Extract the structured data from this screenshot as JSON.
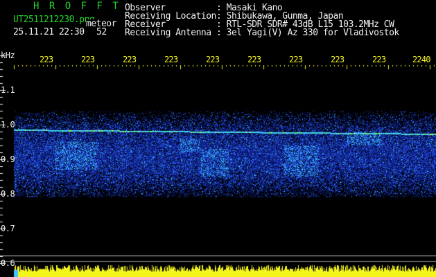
{
  "header": {
    "app_title": "H R O F F T",
    "filename": "UT2511212230.png",
    "mode": "meteor",
    "datetime": "25.11.21 22:30",
    "count": "52",
    "info": [
      {
        "label": "Observer",
        "value": ": Masaki Kano"
      },
      {
        "label": "Receiving Location",
        "value": ": Shibukawa, Gunma, Japan"
      },
      {
        "label": "Receiver",
        "value": ": RTL-SDR SDR# 43dB L15 103.2MHz CW"
      },
      {
        "label": "Receiving Antenna",
        "value": ": 3el Yagi(V) Az 330 for Vladivostok"
      }
    ]
  },
  "axes": {
    "y_unit": "kHz",
    "y_ticks": [
      "1.1",
      "1.0",
      "0.9",
      "0.8",
      "0.7",
      "0.6"
    ],
    "x_ticks": [
      "223",
      "223",
      "223",
      "223",
      "223",
      "223",
      "223",
      "223",
      "223",
      "2240"
    ]
  },
  "colors": {
    "background": "#000000",
    "title": "#22d22a",
    "text": "#f0f0f0",
    "ticks": "#f5f51e",
    "signal_band": "#1e3cc8",
    "carrier_line": "#3cc8ff",
    "level_bar": "#f5f51e"
  }
}
